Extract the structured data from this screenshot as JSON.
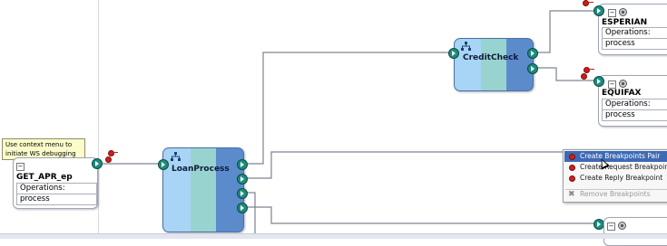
{
  "tooltip": {
    "line1": "Use context menu to",
    "line2": "initiate WS debugging"
  },
  "exposed_service": {
    "name": "GET_APR_ep",
    "operations_label": "Operations:",
    "operation": "process"
  },
  "components": [
    {
      "name": "LoanProcess"
    },
    {
      "name": "CreditCheck"
    }
  ],
  "references": [
    {
      "name": "ESPERIAN",
      "operations_label": "Operations:",
      "operation": "process"
    },
    {
      "name": "EQUIFAX",
      "operations_label": "Operations:",
      "operation": "process"
    }
  ],
  "context_menu": {
    "items": [
      {
        "label": "Create Breakpoints Pair",
        "highlighted": true,
        "enabled": true,
        "icon": "breakpoint-icon"
      },
      {
        "label": "Create Request Breakpoint",
        "highlighted": false,
        "enabled": true,
        "icon": "breakpoint-icon"
      },
      {
        "label": "Create Reply Breakpoint",
        "highlighted": false,
        "enabled": true,
        "icon": "breakpoint-icon"
      },
      {
        "label": "Remove Breakpoints",
        "highlighted": false,
        "enabled": false,
        "icon": "remove-icon"
      }
    ]
  },
  "colors": {
    "wire": "#7d8390",
    "port": "#1b8d7d",
    "breakpoint": "#d11c1c",
    "menu_highlight": "#3d6ab5",
    "tooltip_bg": "#fcfccb"
  }
}
